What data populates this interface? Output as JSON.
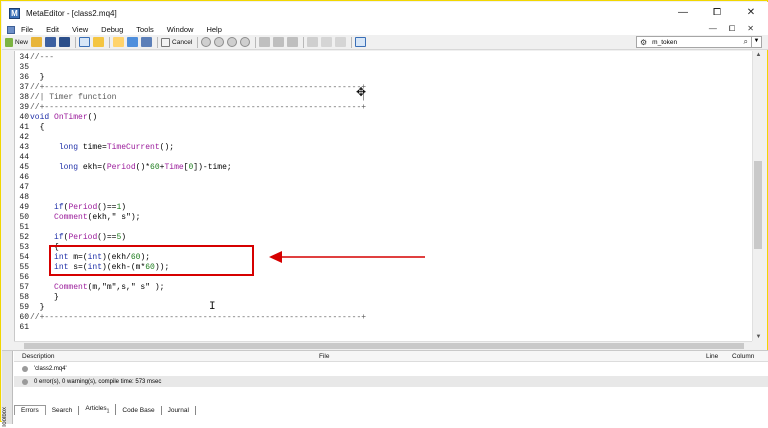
{
  "window": {
    "app_icon": "editor-icon",
    "title": "MetaEditor - [class2.mq4]",
    "buttons": [
      "—",
      "⧠",
      "✕"
    ]
  },
  "menu": {
    "items": [
      "File",
      "Edit",
      "View",
      "Debug",
      "Tools",
      "Window",
      "Help"
    ],
    "mdi_buttons": [
      "—",
      "⧠",
      "✕"
    ]
  },
  "toolbar": {
    "new_label": "New",
    "cancel_label": "Cancel",
    "search_value": "m_token",
    "search_icon": "search-icon"
  },
  "editor": {
    "lines": [
      {
        "num": "34",
        "text": "//---"
      },
      {
        "num": "35",
        "text": ""
      },
      {
        "num": "36",
        "text": "  }"
      },
      {
        "num": "37",
        "text": "//+------------------------------------------------------------------+"
      },
      {
        "num": "38",
        "text": "//| Timer function                                                   |"
      },
      {
        "num": "39",
        "text": "//+------------------------------------------------------------------+"
      },
      {
        "num": "40",
        "text": "void OnTimer()"
      },
      {
        "num": "41",
        "text": "  {"
      },
      {
        "num": "42",
        "text": ""
      },
      {
        "num": "43",
        "text": "      long time=TimeCurrent();"
      },
      {
        "num": "44",
        "text": ""
      },
      {
        "num": "45",
        "text": "      long ekh=(Period()*60+Time[0])-time;"
      },
      {
        "num": "46",
        "text": ""
      },
      {
        "num": "47",
        "text": ""
      },
      {
        "num": "48",
        "text": ""
      },
      {
        "num": "49",
        "text": "     if(Period()==1)"
      },
      {
        "num": "50",
        "text": "     Comment(ekh,\" s\");"
      },
      {
        "num": "51",
        "text": ""
      },
      {
        "num": "52",
        "text": "     if(Period()==5)"
      },
      {
        "num": "53",
        "text": "     {"
      },
      {
        "num": "54",
        "text": "     int m=(int)(ekh/60);"
      },
      {
        "num": "55",
        "text": "     int s=(int)(ekh-(m*60));"
      },
      {
        "num": "56",
        "text": ""
      },
      {
        "num": "57",
        "text": "     Comment(m,\"m\",s,\" s\" );"
      },
      {
        "num": "58",
        "text": "     }"
      },
      {
        "num": "59",
        "text": "  }"
      },
      {
        "num": "60",
        "text": "//+------------------------------------------------------------------+"
      },
      {
        "num": "61",
        "text": ""
      }
    ]
  },
  "panel": {
    "columns": {
      "description": "Description",
      "file": "File",
      "line": "Line",
      "column": "Column"
    },
    "rows": [
      "'class2.mq4'",
      "0 error(s), 0 warning(s), compile time: 573 msec"
    ],
    "tabs": [
      "Errors",
      "Search",
      "Articles",
      "Code Base",
      "Journal"
    ],
    "articles_badge": "1",
    "toolbox_label": "Toolbox"
  },
  "colors": {
    "highlight_box": "#d60000",
    "keyword": "#1f2fa8",
    "function": "#9b1b9b"
  }
}
